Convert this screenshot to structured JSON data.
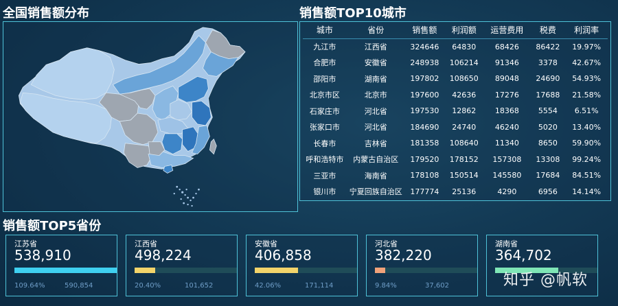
{
  "map": {
    "title": "全国销售额分布"
  },
  "table": {
    "title": "销售额TOP10城市",
    "headers": [
      "城市",
      "省份",
      "销售额",
      "利润额",
      "运营费用",
      "税费",
      "利润率"
    ],
    "rows": [
      [
        "九江市",
        "江西省",
        "324646",
        "64830",
        "68426",
        "86422",
        "19.97%"
      ],
      [
        "合肥市",
        "安徽省",
        "248938",
        "106214",
        "91346",
        "3378",
        "42.67%"
      ],
      [
        "邵阳市",
        "湖南省",
        "197802",
        "108650",
        "89048",
        "24690",
        "54.93%"
      ],
      [
        "北京市区",
        "北京市",
        "197600",
        "42636",
        "17276",
        "17688",
        "21.58%"
      ],
      [
        "石家庄市",
        "河北省",
        "197530",
        "12862",
        "18368",
        "5554",
        "6.51%"
      ],
      [
        "张家口市",
        "河北省",
        "184690",
        "24740",
        "46240",
        "5020",
        "13.40%"
      ],
      [
        "长春市",
        "吉林省",
        "181358",
        "108640",
        "11340",
        "8650",
        "59.90%"
      ],
      [
        "呼和浩特市",
        "内蒙古自治区",
        "179520",
        "178152",
        "157308",
        "13308",
        "99.24%"
      ],
      [
        "三亚市",
        "海南省",
        "178108",
        "150514",
        "145580",
        "17684",
        "84.51%"
      ],
      [
        "银川市",
        "宁夏回族自治区",
        "177774",
        "25136",
        "4290",
        "6956",
        "14.14%"
      ]
    ]
  },
  "top5": {
    "title": "销售额TOP5省份",
    "cards": [
      {
        "province": "江苏省",
        "value": "538,910",
        "rate": "109.64%",
        "total": "590,854",
        "fill": 1.0,
        "color": "#3fd0f0"
      },
      {
        "province": "江西省",
        "value": "498,224",
        "rate": "20.40%",
        "total": "101,652",
        "fill": 0.204,
        "color": "#f3d46a"
      },
      {
        "province": "安徽省",
        "value": "406,858",
        "rate": "42.06%",
        "total": "171,114",
        "fill": 0.42,
        "color": "#f3d46a"
      },
      {
        "province": "河北省",
        "value": "382,220",
        "rate": "9.84%",
        "total": "37,602",
        "fill": 0.098,
        "color": "#f0a27a"
      },
      {
        "province": "湖南省",
        "value": "364,702",
        "rate": "",
        "total": "",
        "fill": 0.62,
        "color": "#7fe6b6"
      }
    ]
  },
  "watermark": "知乎 @帆软",
  "colors": {
    "border": "#4fc3d9",
    "background": "#133a55",
    "map_light": "#a8c8e8",
    "map_mid": "#6aa4d8",
    "map_dark": "#3d85c8",
    "map_gray": "#9ea6b0"
  }
}
